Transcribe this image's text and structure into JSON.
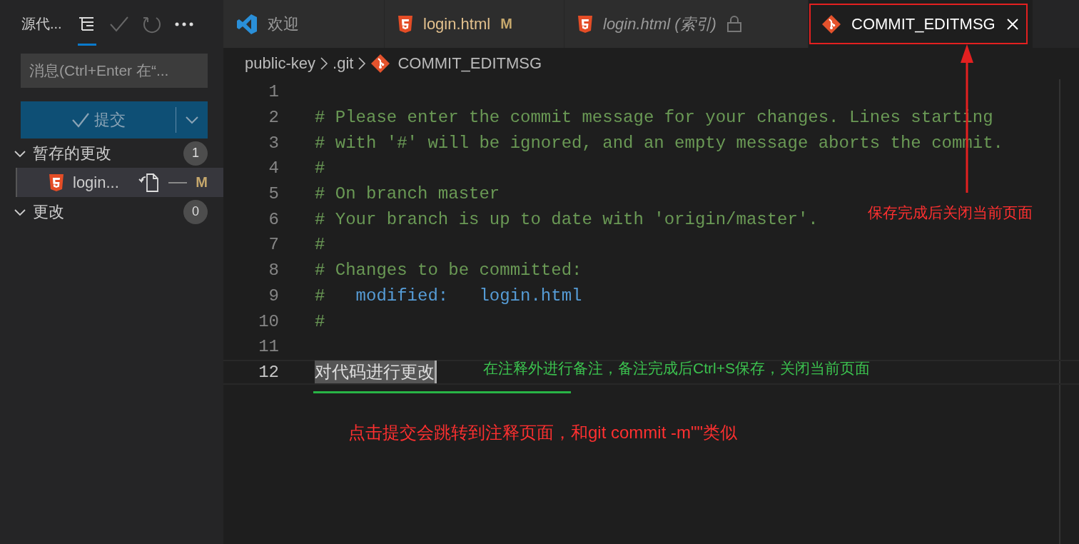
{
  "sidebar": {
    "title": "源代...",
    "message": {
      "placeholder": "消息(Ctrl+Enter 在“..."
    },
    "commit_button": {
      "label": "提交"
    },
    "groups": [
      {
        "label": "暂存的更改",
        "count": "1",
        "expanded": true,
        "children": [
          {
            "name": "login...",
            "status": "M",
            "selected": true
          }
        ]
      },
      {
        "label": "更改",
        "count": "0",
        "expanded": true
      }
    ]
  },
  "tabs": [
    {
      "kind": "vscode",
      "label": "欢迎",
      "preview": false,
      "locked": false,
      "selected": false
    },
    {
      "kind": "html",
      "label": "login.html",
      "status": "M",
      "preview": false,
      "locked": false,
      "selected": false
    },
    {
      "kind": "html",
      "label": "login.html (索引)",
      "preview": true,
      "locked": true,
      "selected": false
    },
    {
      "kind": "git",
      "label": "COMMIT_EDITMSG",
      "preview": false,
      "locked": false,
      "selected": true
    }
  ],
  "breadcrumb": [
    {
      "label": "public-key",
      "kind": "folder"
    },
    {
      "label": ".git",
      "kind": "folder"
    },
    {
      "label": "COMMIT_EDITMSG",
      "kind": "git"
    }
  ],
  "editor": {
    "lines": [
      {
        "number": "1",
        "current": false
      },
      {
        "number": "2",
        "current": false,
        "segments": [
          {
            "kind": "comment",
            "text": "# Please enter the commit message for your changes. Lines starting"
          }
        ]
      },
      {
        "number": "3",
        "current": false,
        "segments": [
          {
            "kind": "comment",
            "text": "# with '#' will be ignored, and an empty message aborts the commit."
          }
        ]
      },
      {
        "number": "4",
        "current": false,
        "segments": [
          {
            "kind": "comment",
            "text": "#"
          }
        ]
      },
      {
        "number": "5",
        "current": false,
        "segments": [
          {
            "kind": "comment",
            "text": "# On branch master"
          }
        ]
      },
      {
        "number": "6",
        "current": false,
        "segments": [
          {
            "kind": "comment",
            "text": "# Your branch is up to date with 'origin/master'."
          }
        ]
      },
      {
        "number": "7",
        "current": false,
        "segments": [
          {
            "kind": "comment",
            "text": "#"
          }
        ]
      },
      {
        "number": "8",
        "current": false,
        "segments": [
          {
            "kind": "comment",
            "text": "# Changes to be committed:"
          }
        ]
      },
      {
        "number": "9",
        "current": false,
        "segments": [
          {
            "kind": "comment",
            "text": "#"
          },
          {
            "kind": "keyword",
            "text": "modified:"
          },
          {
            "kind": "keyword",
            "text": "login.html"
          }
        ]
      },
      {
        "number": "10",
        "current": false,
        "segments": [
          {
            "kind": "comment",
            "text": "#"
          }
        ]
      },
      {
        "number": "11",
        "current": false
      },
      {
        "number": "12",
        "current": true,
        "segments": [
          {
            "kind": "selected",
            "text": "对代码进行更改"
          }
        ]
      }
    ]
  },
  "annotations": {
    "close_note": "保存完成后关闭当前页面",
    "line_note": "在注释外进行备注，备注完成后Ctrl+S保存，关闭当前页面",
    "commit_note": "点击提交会跳转到注释页面，和git commit -m\"\"类似"
  }
}
